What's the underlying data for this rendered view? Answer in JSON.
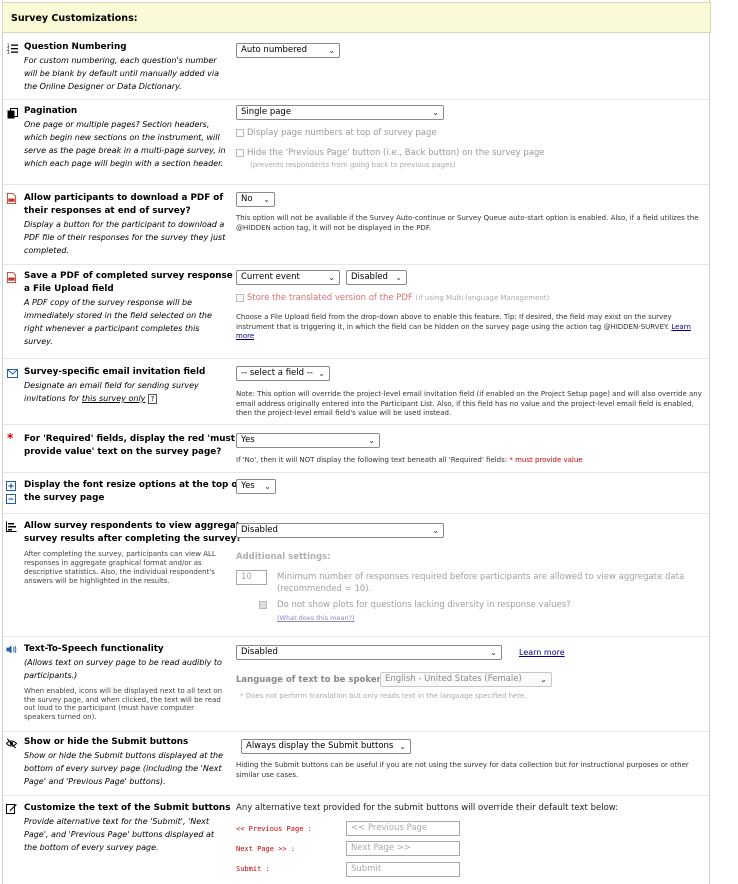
{
  "header": {
    "title": "Survey Customizations:"
  },
  "question_numbering": {
    "title": "Question Numbering",
    "desc": [
      "For custom numbering, each question's number",
      "will be blank by default until manually added via",
      "the Online Designer or Data Dictionary."
    ],
    "value": "Auto numbered"
  },
  "pagination": {
    "title": "Pagination",
    "desc": [
      "One page or multiple pages? Section headers,",
      "which begin new sections on the instrument, will",
      "serve as the page break in a multi-page survey, in",
      "which each page will begin with a section header."
    ],
    "value": "Single page",
    "opt1": "Display page numbers at top of survey page",
    "opt2": "Hide the 'Previous Page' button (i.e., Back button) on the survey page",
    "opt2_sub": "(prevents respondents from going back to previous pages)"
  },
  "pdf_download": {
    "title": [
      "Allow participants to download a PDF of",
      "their responses at end of survey?"
    ],
    "desc": [
      "Display a button for the participant to download a",
      "PDF file of their responses for the survey they just",
      "completed."
    ],
    "value": "No",
    "note": [
      "This option will not be available if the Survey Auto-continue or Survey Queue auto-start option is enabled. Also, if a field utilizes the",
      "@HIDDEN action tag, it will not be displayed in the PDF."
    ]
  },
  "pdf_save": {
    "title": [
      "Save a PDF of completed survey response to",
      "a File Upload field"
    ],
    "desc": [
      "A PDF copy of the survey response will be",
      "immediately stored in the field selected on the",
      "right whenever a participant completes this",
      "survey."
    ],
    "value1": "Current event",
    "value2": "Disabled",
    "opt": "Store the translated version of the PDF",
    "opt_sub": "(if using Multi-language Management)",
    "note": [
      "Choose a File Upload field from the drop-down above to enable this feature. Tip: If desired, the field may exist on the survey",
      "instrument that is triggering it, in which the field can be hidden on the survey page using the action tag @HIDDEN-SURVEY."
    ],
    "learn_more_a": "Learn",
    "learn_more_b": "more"
  },
  "email_field": {
    "title": "Survey-specific email invitation field",
    "desc1": "Designate an email field for sending survey",
    "desc2": "invitations for",
    "desc2_link": "this survey only",
    "help": "?",
    "value": "-- select a field --",
    "note": [
      "Note: This option will override the project-level email invitation field (if enabled on the Project Setup page) and will also override any",
      "email address originally entered into the Participant List. Also, if this field has no value and the project-level email field is enabled,",
      "then the project-level email field's value will be used instead."
    ]
  },
  "required_text": {
    "title": [
      "For 'Required' fields, display the red 'must",
      "provide value' text on the survey page?"
    ],
    "value": "Yes",
    "note": "If 'No', then it will NOT display the following text beneath all 'Required' fields:",
    "note_red": "* must provide value"
  },
  "font_resize": {
    "title": [
      "Display the font resize options at the top of",
      "the survey page"
    ],
    "value": "Yes"
  },
  "aggregate": {
    "title": [
      "Allow survey respondents to view aggregate",
      "survey results after completing the survey?"
    ],
    "desc": [
      "After completing the survey, participants can view ALL",
      "responses in aggregate graphical format and/or as",
      "descriptive statistics. Also, the individual respondent's",
      "answers will be highlighted in the results."
    ],
    "value": "Disabled",
    "additional": "Additional settings:",
    "min_value": "10",
    "min_text": [
      "Minimum number of responses required before participants are allowed to view aggregate data",
      "(recommended = 10)."
    ],
    "noplot_text": "Do not show plots for questions lacking diversity in response values?",
    "noplot_link": "(What does this mean?)"
  },
  "tts": {
    "title": "Text-To-Speech functionality",
    "desc": [
      "(Allows text on survey page to be read audibly to",
      "participants.)"
    ],
    "desc_small": [
      "When enabled, icons will be displayed next to all text on",
      "the survey page, and when clicked, the text will be read",
      "out loud to the participant (must have computer",
      "speakers turned on)."
    ],
    "value": "Disabled",
    "learn_more": "Learn more",
    "lang_label": "Language of text to be spoken:",
    "lang_value": "English - United States (Female)",
    "lang_note": "* Does not perform translation but only reads text in the language specified here."
  },
  "submit_buttons": {
    "title": "Show or hide the Submit buttons",
    "desc": [
      "Show or hide the Submit buttons displayed at the",
      "bottom of every survey page (including the 'Next",
      "Page' and 'Previous Page' buttons)."
    ],
    "value": "Always display the Submit buttons",
    "note": [
      "Hiding the Submit buttons can be useful if you are not using the survey for data collection but for instructional purposes or other",
      "similar use cases."
    ]
  },
  "custom_text": {
    "title": "Customize the text of the Submit buttons",
    "desc": [
      "Provide alternative text for the 'Submit', 'Next",
      "Page', and 'Previous Page' buttons displayed at",
      "the bottom of every survey page."
    ],
    "note": "Any alternative text provided for the submit buttons will override their default text below:",
    "prev_label": "<< Previous Page :",
    "prev_placeholder": "<< Previous Page",
    "next_label": "Next Page >> :",
    "next_placeholder": "Next Page >>",
    "submit_label": "Submit :",
    "submit_placeholder": "Submit"
  },
  "colors": {
    "header_bg": "#fafad7",
    "link": "#000088",
    "required_red": "#cc0000",
    "icon_blue": "#1f5fa8",
    "pdf_red": "#c0392b"
  }
}
